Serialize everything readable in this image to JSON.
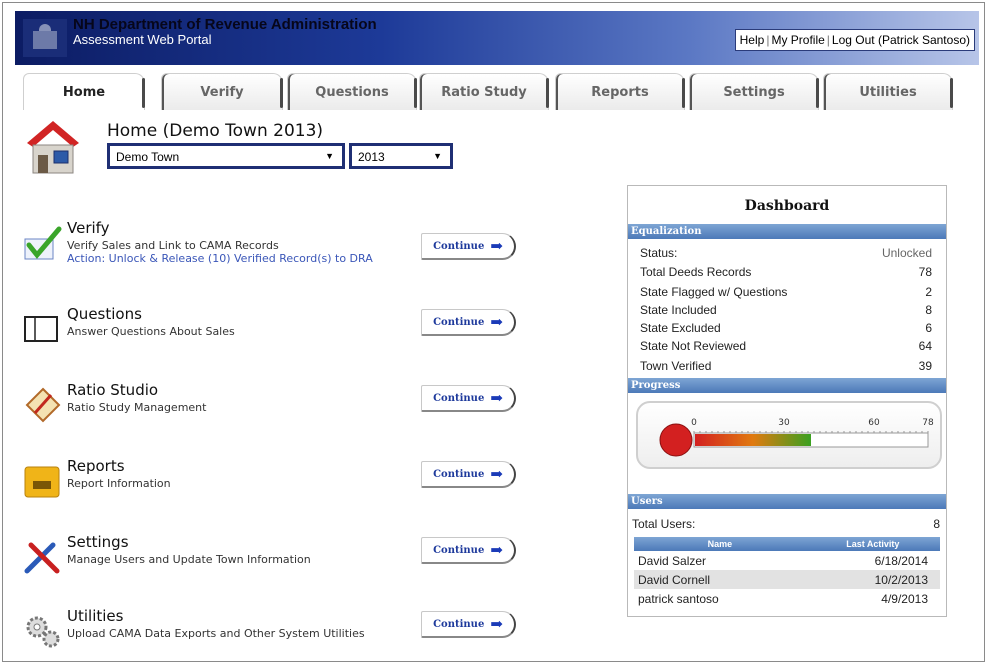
{
  "header": {
    "org_title": "NH Department of Revenue Administration",
    "portal_title": "Assessment Web Portal",
    "links": {
      "help": "Help",
      "profile": "My Profile",
      "logout": "Log Out (Patrick Santoso)"
    }
  },
  "tabs": [
    {
      "label": "Home",
      "active": true
    },
    {
      "label": "Verify"
    },
    {
      "label": "Questions"
    },
    {
      "label": "Ratio Study"
    },
    {
      "label": "Reports"
    },
    {
      "label": "Settings"
    },
    {
      "label": "Utilities"
    }
  ],
  "home": {
    "title": "Home (Demo Town 2013)",
    "town_select": "Demo Town",
    "year_select": "2013"
  },
  "sections": [
    {
      "title": "Verify",
      "desc": "Verify Sales and Link to CAMA Records",
      "action": "Action: Unlock & Release (10) Verified Record(s) to DRA",
      "button": "Continue",
      "icon": "verify-check-icon"
    },
    {
      "title": "Questions",
      "desc": "Answer Questions About Sales",
      "button": "Continue",
      "icon": "questions-book-icon"
    },
    {
      "title": "Ratio Studio",
      "desc": "Ratio Study Management",
      "button": "Continue",
      "icon": "ratio-study-icon"
    },
    {
      "title": "Reports",
      "desc": "Report Information",
      "button": "Continue",
      "icon": "reports-folder-icon"
    },
    {
      "title": "Settings",
      "desc": "Manage Users and Update Town Information",
      "button": "Continue",
      "icon": "settings-tools-icon"
    },
    {
      "title": "Utilities",
      "desc": "Upload CAMA Data Exports and Other System Utilities",
      "button": "Continue",
      "icon": "utilities-gears-icon"
    }
  ],
  "dashboard": {
    "title": "Dashboard",
    "equalization_label": "Equalization",
    "stats": [
      {
        "label": "Status:",
        "value": "Unlocked"
      },
      {
        "label": "Total Deeds Records",
        "value": "78"
      },
      {
        "label": "State Flagged w/ Questions",
        "value": "2"
      },
      {
        "label": "State Included",
        "value": "8"
      },
      {
        "label": "State Excluded",
        "value": "6"
      },
      {
        "label": "State Not Reviewed",
        "value": "64"
      },
      {
        "label": "Town Verified",
        "value": "39"
      }
    ],
    "progress_label": "Progress",
    "progress": {
      "scale_labels": [
        "0",
        "30",
        "60",
        "78"
      ],
      "max": 78,
      "value": 39,
      "colors": [
        "#d32020",
        "#e07a10",
        "#3aa020"
      ]
    },
    "users_label": "Users",
    "total_users_label": "Total Users:",
    "total_users": "8",
    "table_headers": [
      "Name",
      "Last Activity"
    ],
    "users": [
      {
        "name": "David Salzer",
        "last": "6/18/2014"
      },
      {
        "name": "David Cornell",
        "last": "10/2/2013"
      },
      {
        "name": "patrick santoso",
        "last": "4/9/2013"
      }
    ]
  }
}
